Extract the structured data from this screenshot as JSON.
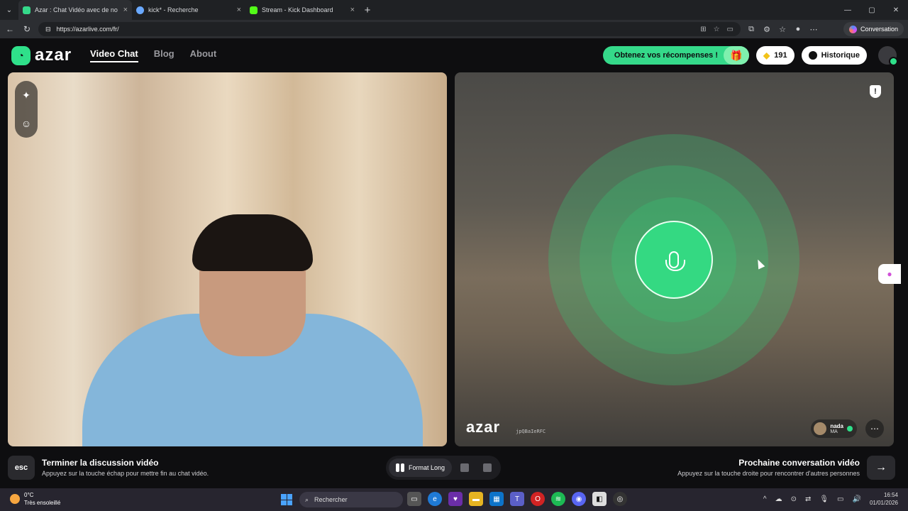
{
  "browser": {
    "tabs": [
      {
        "title": "Azar : Chat Vidéo avec de no",
        "active": true,
        "color": "#35d98a"
      },
      {
        "title": "kick* - Recherche",
        "active": false,
        "color": "#6aa9ff"
      },
      {
        "title": "Stream - Kick Dashboard",
        "active": false,
        "color": "#53fc18"
      }
    ],
    "url": "https://azarlive.com/fr/",
    "conversation_label": "Conversation"
  },
  "header": {
    "logo_text": "azar",
    "nav": [
      {
        "label": "Video Chat",
        "active": true
      },
      {
        "label": "Blog",
        "active": false
      },
      {
        "label": "About",
        "active": false
      }
    ],
    "rewards_label": "Obtenez vos récompenses !",
    "gems": "191",
    "history_label": "Historique"
  },
  "remote": {
    "watermark": "azar",
    "watermark_id": "jpQBaIeRFC",
    "user_name": "nada",
    "user_country": "MA"
  },
  "bottom": {
    "esc_key": "esc",
    "end_title": "Terminer la discussion vidéo",
    "end_sub": "Appuyez sur la touche échap pour mettre fin au chat vidéo.",
    "format_label": "Format Long",
    "next_title": "Prochaine conversation vidéo",
    "next_sub": "Appuyez sur la touche droite pour rencontrer d'autres personnes"
  },
  "taskbar": {
    "temp": "0°C",
    "weather": "Très ensoleillé",
    "search_placeholder": "Rechercher",
    "time": "16:54",
    "date": "01/01/2026"
  },
  "colors": {
    "accent": "#35d98a",
    "background": "#0e0e10"
  }
}
